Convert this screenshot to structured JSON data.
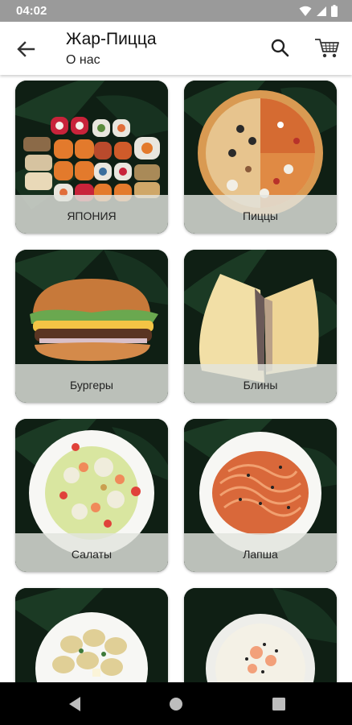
{
  "status_bar": {
    "time": "04:02"
  },
  "app_bar": {
    "title": "Жар-Пицца",
    "subtitle": "О нас"
  },
  "categories": [
    {
      "label": "ЯПОНИЯ"
    },
    {
      "label": "Пиццы"
    },
    {
      "label": "Бургеры"
    },
    {
      "label": "Блины"
    },
    {
      "label": "Салаты"
    },
    {
      "label": "Лапша"
    },
    {
      "label": ""
    },
    {
      "label": ""
    }
  ],
  "colors": {
    "card_bg": "#0f1f14",
    "label_band": "#e2e4de",
    "status_bar": "#9a9a9a"
  }
}
